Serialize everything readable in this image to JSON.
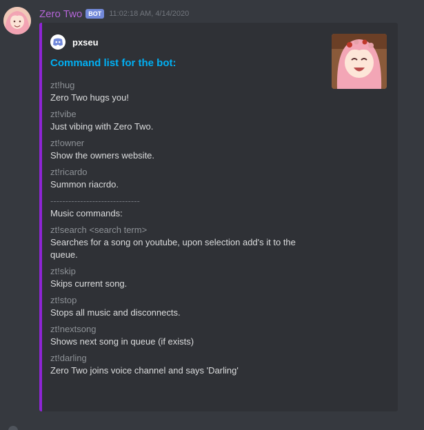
{
  "message": {
    "username": "Zero Two",
    "bot_tag": "BOT",
    "timestamp": "11:02:18 AM, 4/14/2020"
  },
  "embed": {
    "author": "pxseu",
    "title": "Command list for the bot:",
    "commands": [
      {
        "cmd": "zt!hug",
        "desc": "Zero Two hugs you!"
      },
      {
        "cmd": "zt!vibe",
        "desc": "Just vibing with Zero Two."
      },
      {
        "cmd": "zt!owner",
        "desc": "Show the owners website."
      },
      {
        "cmd": "zt!ricardo",
        "desc": "Summon riacrdo."
      }
    ],
    "divider": "------------------------------",
    "music_header": "Music commands:",
    "music_commands": [
      {
        "cmd": "zt!search <search term>",
        "desc": "Searches for a song on youtube, upon selection add's it to the queue."
      },
      {
        "cmd": "zt!skip",
        "desc": "Skips current song."
      },
      {
        "cmd": "zt!stop",
        "desc": "Stops all music and disconnects."
      },
      {
        "cmd": "zt!nextsong",
        "desc": "Shows next song in queue (if exists)"
      },
      {
        "cmd": "zt!darling",
        "desc": "Zero Two joins voice channel and says 'Darling'"
      }
    ]
  },
  "colors": {
    "background": "#36393f",
    "embed_bg": "#2f3136",
    "embed_border": "#8e24d6",
    "username": "#b565d8",
    "title": "#00b0f4"
  }
}
